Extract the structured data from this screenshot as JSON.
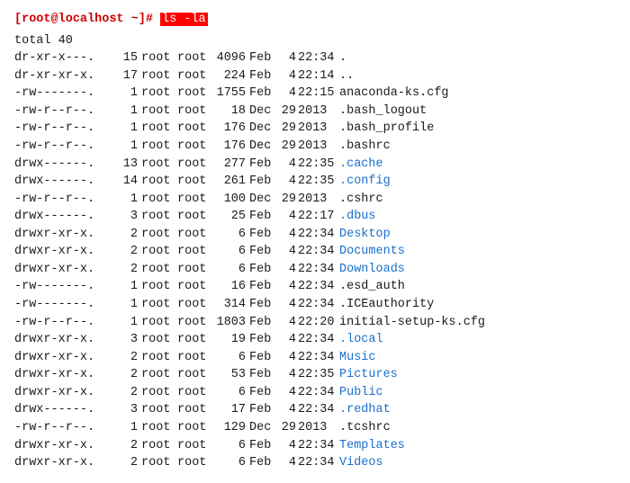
{
  "prompt": {
    "user": "[root@localhost ~]#",
    "cmd_prefix": " ",
    "cmd": "ls -la",
    "total": "total 40"
  },
  "entries": [
    {
      "perms": "dr-xr-x---.",
      "links": "15",
      "owner": "root",
      "group": "root",
      "size": "4096",
      "month": "Feb",
      "day": "4",
      "time": "22:34",
      "name": ".",
      "color": false
    },
    {
      "perms": "dr-xr-xr-x.",
      "links": "17",
      "owner": "root",
      "group": "root",
      "size": "224",
      "month": "Feb",
      "day": "4",
      "time": "22:14",
      "name": "..",
      "color": false
    },
    {
      "perms": "-rw-------.",
      "links": "1",
      "owner": "root",
      "group": "root",
      "size": "1755",
      "month": "Feb",
      "day": "4",
      "time": "22:15",
      "name": "anaconda-ks.cfg",
      "color": false
    },
    {
      "perms": "-rw-r--r--.",
      "links": "1",
      "owner": "root",
      "group": "root",
      "size": "18",
      "month": "Dec",
      "day": "29",
      "time": "2013",
      "name": ".bash_logout",
      "color": false
    },
    {
      "perms": "-rw-r--r--.",
      "links": "1",
      "owner": "root",
      "group": "root",
      "size": "176",
      "month": "Dec",
      "day": "29",
      "time": "2013",
      "name": ".bash_profile",
      "color": false
    },
    {
      "perms": "-rw-r--r--.",
      "links": "1",
      "owner": "root",
      "group": "root",
      "size": "176",
      "month": "Dec",
      "day": "29",
      "time": "2013",
      "name": ".bashrc",
      "color": false
    },
    {
      "perms": "drwx------.",
      "links": "13",
      "owner": "root",
      "group": "root",
      "size": "277",
      "month": "Feb",
      "day": "4",
      "time": "22:35",
      "name": ".cache",
      "color": true
    },
    {
      "perms": "drwx------.",
      "links": "14",
      "owner": "root",
      "group": "root",
      "size": "261",
      "month": "Feb",
      "day": "4",
      "time": "22:35",
      "name": ".config",
      "color": true
    },
    {
      "perms": "-rw-r--r--.",
      "links": "1",
      "owner": "root",
      "group": "root",
      "size": "100",
      "month": "Dec",
      "day": "29",
      "time": "2013",
      "name": ".cshrc",
      "color": false
    },
    {
      "perms": "drwx------.",
      "links": "3",
      "owner": "root",
      "group": "root",
      "size": "25",
      "month": "Feb",
      "day": "4",
      "time": "22:17",
      "name": ".dbus",
      "color": true
    },
    {
      "perms": "drwxr-xr-x.",
      "links": "2",
      "owner": "root",
      "group": "root",
      "size": "6",
      "month": "Feb",
      "day": "4",
      "time": "22:34",
      "name": "Desktop",
      "color": true
    },
    {
      "perms": "drwxr-xr-x.",
      "links": "2",
      "owner": "root",
      "group": "root",
      "size": "6",
      "month": "Feb",
      "day": "4",
      "time": "22:34",
      "name": "Documents",
      "color": true
    },
    {
      "perms": "drwxr-xr-x.",
      "links": "2",
      "owner": "root",
      "group": "root",
      "size": "6",
      "month": "Feb",
      "day": "4",
      "time": "22:34",
      "name": "Downloads",
      "color": true
    },
    {
      "perms": "-rw-------.",
      "links": "1",
      "owner": "root",
      "group": "root",
      "size": "16",
      "month": "Feb",
      "day": "4",
      "time": "22:34",
      "name": ".esd_auth",
      "color": false
    },
    {
      "perms": "-rw-------.",
      "links": "1",
      "owner": "root",
      "group": "root",
      "size": "314",
      "month": "Feb",
      "day": "4",
      "time": "22:34",
      "name": ".ICEauthority",
      "color": false
    },
    {
      "perms": "-rw-r--r--.",
      "links": "1",
      "owner": "root",
      "group": "root",
      "size": "1803",
      "month": "Feb",
      "day": "4",
      "time": "22:20",
      "name": "initial-setup-ks.cfg",
      "color": false
    },
    {
      "perms": "drwxr-xr-x.",
      "links": "3",
      "owner": "root",
      "group": "root",
      "size": "19",
      "month": "Feb",
      "day": "4",
      "time": "22:34",
      "name": ".local",
      "color": true
    },
    {
      "perms": "drwxr-xr-x.",
      "links": "2",
      "owner": "root",
      "group": "root",
      "size": "6",
      "month": "Feb",
      "day": "4",
      "time": "22:34",
      "name": "Music",
      "color": true
    },
    {
      "perms": "drwxr-xr-x.",
      "links": "2",
      "owner": "root",
      "group": "root",
      "size": "53",
      "month": "Feb",
      "day": "4",
      "time": "22:35",
      "name": "Pictures",
      "color": true
    },
    {
      "perms": "drwxr-xr-x.",
      "links": "2",
      "owner": "root",
      "group": "root",
      "size": "6",
      "month": "Feb",
      "day": "4",
      "time": "22:34",
      "name": "Public",
      "color": true
    },
    {
      "perms": "drwx------.",
      "links": "3",
      "owner": "root",
      "group": "root",
      "size": "17",
      "month": "Feb",
      "day": "4",
      "time": "22:34",
      "name": ".redhat",
      "color": true
    },
    {
      "perms": "-rw-r--r--.",
      "links": "1",
      "owner": "root",
      "group": "root",
      "size": "129",
      "month": "Dec",
      "day": "29",
      "time": "2013",
      "name": ".tcshrc",
      "color": false
    },
    {
      "perms": "drwxr-xr-x.",
      "links": "2",
      "owner": "root",
      "group": "root",
      "size": "6",
      "month": "Feb",
      "day": "4",
      "time": "22:34",
      "name": "Templates",
      "color": true
    },
    {
      "perms": "drwxr-xr-x.",
      "links": "2",
      "owner": "root",
      "group": "root",
      "size": "6",
      "month": "Feb",
      "day": "4",
      "time": "22:34",
      "name": "Videos",
      "color": true
    }
  ]
}
